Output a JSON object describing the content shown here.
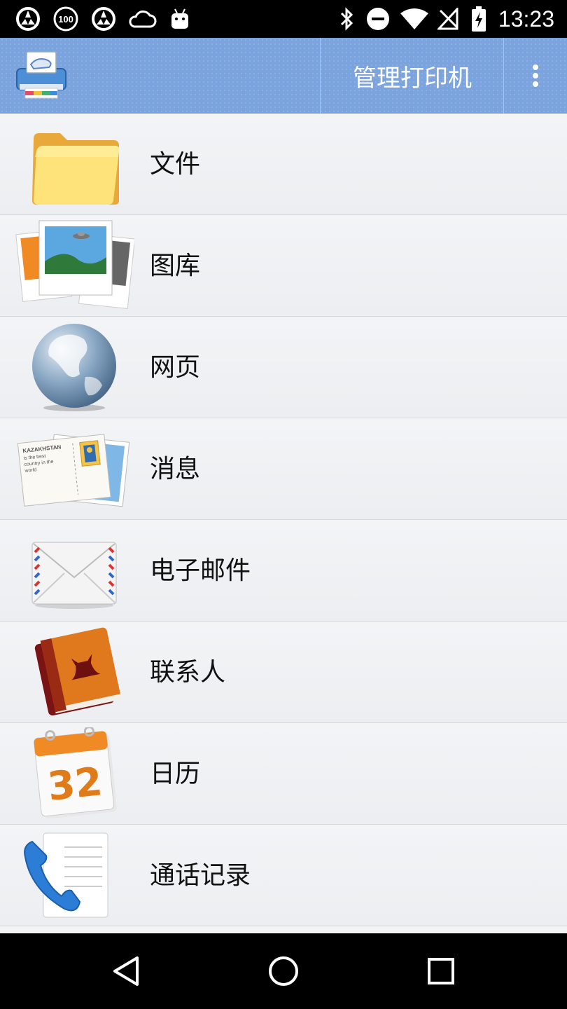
{
  "status_bar": {
    "time": "13:23",
    "notification_badge": "100",
    "left_icons": [
      "vpn-shield-icon",
      "badge-100-icon",
      "vpn-shield-icon",
      "cloud-icon",
      "android-icon"
    ],
    "right_icons": [
      "bluetooth-icon",
      "do-not-disturb-icon",
      "wifi-icon",
      "no-sim-icon",
      "battery-charging-icon"
    ]
  },
  "action_bar": {
    "manage_printer_label": "管理打印机",
    "logo": "printer-logo-icon",
    "overflow": "overflow-menu-icon",
    "accent": "#7ba3de"
  },
  "list": {
    "items": [
      {
        "id": "files",
        "label": "文件",
        "icon": "folder-icon"
      },
      {
        "id": "gallery",
        "label": "图库",
        "icon": "photos-icon"
      },
      {
        "id": "web",
        "label": "网页",
        "icon": "globe-icon"
      },
      {
        "id": "messages",
        "label": "消息",
        "icon": "postcard-icon"
      },
      {
        "id": "email",
        "label": "电子邮件",
        "icon": "envelope-icon"
      },
      {
        "id": "contacts",
        "label": "联系人",
        "icon": "address-book-icon"
      },
      {
        "id": "calendar",
        "label": "日历",
        "icon": "calendar-icon",
        "icon_text": "32"
      },
      {
        "id": "call_log",
        "label": "通话记录",
        "icon": "phone-log-icon"
      }
    ],
    "postcard_text": [
      "KAZAKHSTAN",
      "is the best",
      "country in the",
      "world"
    ]
  },
  "nav_bar": {
    "buttons": [
      "back-icon",
      "home-icon",
      "recents-icon"
    ]
  }
}
